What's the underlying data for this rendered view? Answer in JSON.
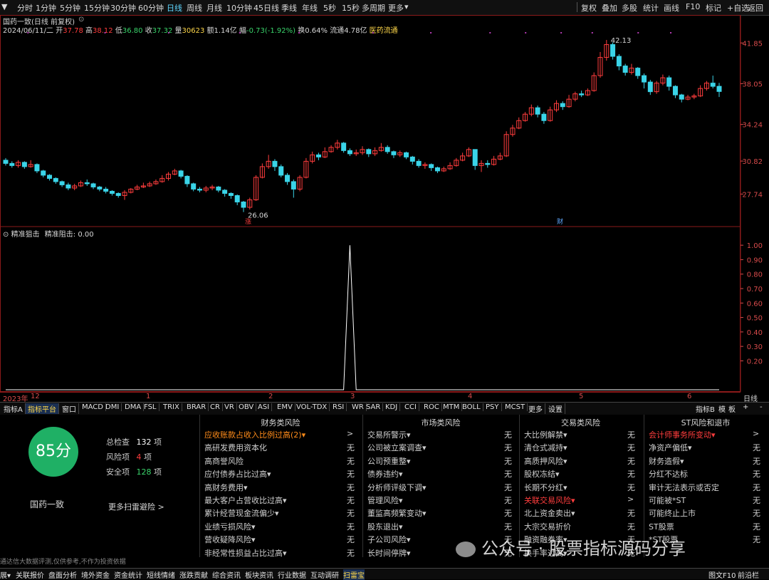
{
  "period_bar": {
    "items": [
      "分时",
      "1分钟",
      "5分钟",
      "15分钟",
      "30分钟",
      "60分钟",
      "日线",
      "周线",
      "月线",
      "10分钟",
      "45日线",
      "季线",
      "年线",
      "5秒",
      "15秒",
      "多周期",
      "更多"
    ],
    "active_index": 6,
    "right_items": [
      "复权",
      "叠加",
      "多股",
      "统计",
      "画线",
      "F10",
      "标记",
      "+自选",
      "返回"
    ]
  },
  "chart_header": {
    "title": "国药一致(日线 前复权)",
    "date": "2024/06/11/二",
    "open_label": "开",
    "open": "37.78",
    "high_label": "高",
    "high": "38.12",
    "low_label": "低",
    "low": "36.80",
    "close_label": "收",
    "close": "37.32",
    "volume_label": "量",
    "volume": "30623",
    "amount_label": "额",
    "amount": "1.14亿",
    "change_label": "幅",
    "change": "-0.73(-1.92%)",
    "turnover_label": "换",
    "turnover": "0.64%",
    "float_label": "流通",
    "float": "4.78亿",
    "sector": "医药流通"
  },
  "price_axis": [
    "41.85",
    "38.05",
    "34.24",
    "30.82",
    "27.74"
  ],
  "annotations": {
    "high": "42.13",
    "low": "26.06",
    "marker_up": "涨",
    "marker_fin": "财"
  },
  "indicator_panel": {
    "name": "精准狙击",
    "label": "精准阻击: 0.00",
    "axis": [
      "1.00",
      "0.90",
      "0.80",
      "0.70",
      "0.60",
      "0.50",
      "0.40",
      "0.30",
      "0.20"
    ]
  },
  "date_axis": {
    "ticks": [
      "2023年",
      "12",
      "1",
      "2",
      "3",
      "4",
      "5",
      "6"
    ],
    "right_label": "日线"
  },
  "indicator_tabs": [
    "指标A",
    "指标平台",
    "窗口",
    "MACD",
    "DMI",
    "DMA",
    "FSL",
    "TRIX",
    "BRAR",
    "CR",
    "VR",
    "OBV",
    "ASI",
    "EMV",
    "VOL-TDX",
    "RSI",
    "WR",
    "SAR",
    "KDJ",
    "CCI",
    "ROC",
    "MTM",
    "BOLL",
    "PSY",
    "MCST",
    "更多",
    "设置"
  ],
  "indicator_tabs_active": 1,
  "indicator_tabs_right": [
    "指标B",
    "模",
    "板",
    "+",
    "-"
  ],
  "risk": {
    "score": "85分",
    "stock_name": "国药一致",
    "total_label": "总检查",
    "total": "132",
    "total_unit": "项",
    "risk_label": "风险项",
    "risk_count": "4",
    "risk_unit": "项",
    "safe_label": "安全项",
    "safe_count": "128",
    "safe_unit": "项",
    "more_link": "更多扫雷避险 >",
    "disclaimer": "通达信大数据评测,仅供参考,不作为投资依据",
    "columns": [
      {
        "title": "财务类风险",
        "rows": [
          {
            "label": "应收账款占收入比例过高(2)▾",
            "value": ">",
            "flag": true
          },
          {
            "label": "高研发费用资本化",
            "value": "无"
          },
          {
            "label": "高商誉风险",
            "value": "无"
          },
          {
            "label": "应付债券占比过高▾",
            "value": "无"
          },
          {
            "label": "高财务费用▾",
            "value": "无"
          },
          {
            "label": "最大客户占营收比过高▾",
            "value": "无"
          },
          {
            "label": "累计经营现金流偏少▾",
            "value": "无"
          },
          {
            "label": "业绩亏损风险▾",
            "value": "无"
          },
          {
            "label": "营收疑降风险▾",
            "value": "无"
          },
          {
            "label": "非经常性损益占比过高▾",
            "value": "无"
          }
        ]
      },
      {
        "title": "市场类风险",
        "rows": [
          {
            "label": "交易所警示▾",
            "value": "无"
          },
          {
            "label": "公司被立案调查▾",
            "value": "无"
          },
          {
            "label": "公司预重整▾",
            "value": "无"
          },
          {
            "label": "债券违约▾",
            "value": "无"
          },
          {
            "label": "分析师评级下调▾",
            "value": "无"
          },
          {
            "label": "管理风险▾",
            "value": "无"
          },
          {
            "label": "董监高频繁变动▾",
            "value": "无"
          },
          {
            "label": "股东退出▾",
            "value": "无"
          },
          {
            "label": "子公司风险▾",
            "value": "无"
          },
          {
            "label": "长时间停牌▾",
            "value": "无"
          }
        ]
      },
      {
        "title": "交易类风险",
        "rows": [
          {
            "label": "大比例解禁▾",
            "value": "无"
          },
          {
            "label": "清仓式减持▾",
            "value": "无"
          },
          {
            "label": "高质押风险▾",
            "value": "无"
          },
          {
            "label": "股权冻结▾",
            "value": "无"
          },
          {
            "label": "长期不分红▾",
            "value": "无"
          },
          {
            "label": "关联交易风险▾",
            "value": ">",
            "flag": true
          },
          {
            "label": "北上资金卖出▾",
            "value": "无"
          },
          {
            "label": "大宗交易折价",
            "value": "无"
          },
          {
            "label": "融资融券率▾",
            "value": "无"
          },
          {
            "label": "换手率过高▾",
            "value": "无"
          }
        ]
      },
      {
        "title": "ST风险和退市",
        "rows": [
          {
            "label": "会计师事务所变动▾",
            "value": ">",
            "flag": true
          },
          {
            "label": "净资产偏低▾",
            "value": "无"
          },
          {
            "label": "财务造假▾",
            "value": "无"
          },
          {
            "label": "分红不达标",
            "value": "无"
          },
          {
            "label": "审计无法表示或否定",
            "value": "无"
          },
          {
            "label": "可能被*ST",
            "value": "无"
          },
          {
            "label": "可能终止上市",
            "value": "无"
          },
          {
            "label": "ST股票",
            "value": "无"
          },
          {
            "label": "*ST股票",
            "value": "无"
          },
          {
            "label": "",
            "value": ""
          }
        ]
      }
    ]
  },
  "watermark": "公众号 · 股票指标源码分享",
  "bottom_tabs": [
    "展▾",
    "关联报价",
    "盘面分析",
    "境外资金",
    "资金统计",
    "短线情绪",
    "涨跌贡献",
    "综合资讯",
    "板块资讯",
    "行业数据",
    "互动调研",
    "扫雷宝"
  ],
  "bottom_tabs_active": 11,
  "bottom_right": [
    "图文F10",
    "前沿栏"
  ],
  "colors": {
    "up": "#ff3d3d",
    "down": "#3ad4e8",
    "frame": "#8b1a1a",
    "score_bg": "#1fb065",
    "active_tab": "#ffd84a"
  },
  "chart_data": {
    "type": "candlestick",
    "title": "国药一致(日线 前复权)",
    "ylim": [
      25.5,
      43
    ],
    "candles": [
      [
        30.9,
        30.6,
        31.1,
        30.4
      ],
      [
        30.6,
        30.4,
        30.8,
        30.2
      ],
      [
        30.4,
        30.7,
        30.9,
        30.2
      ],
      [
        30.7,
        30.3,
        30.8,
        30.1
      ],
      [
        30.3,
        30.5,
        30.9,
        30.2
      ],
      [
        30.5,
        29.9,
        30.6,
        29.7
      ],
      [
        29.9,
        29.5,
        30.0,
        29.3
      ],
      [
        29.5,
        29.2,
        29.6,
        29.0
      ],
      [
        29.2,
        28.9,
        29.3,
        28.7
      ],
      [
        28.9,
        28.6,
        29.0,
        28.4
      ],
      [
        28.6,
        28.3,
        28.8,
        28.1
      ],
      [
        28.3,
        28.5,
        28.7,
        28.1
      ],
      [
        28.5,
        28.8,
        29.0,
        28.4
      ],
      [
        28.8,
        28.7,
        29.1,
        28.5
      ],
      [
        28.7,
        28.4,
        28.8,
        28.2
      ],
      [
        28.4,
        28.2,
        28.5,
        28.0
      ],
      [
        28.2,
        28.0,
        28.4,
        27.8
      ],
      [
        28.0,
        27.8,
        28.1,
        27.6
      ],
      [
        27.8,
        27.6,
        27.9,
        27.4
      ],
      [
        27.6,
        27.9,
        28.1,
        27.2
      ],
      [
        27.9,
        28.2,
        28.3,
        27.8
      ],
      [
        28.2,
        28.4,
        28.6,
        28.1
      ],
      [
        28.4,
        28.5,
        28.8,
        28.3
      ],
      [
        28.5,
        28.7,
        28.9,
        28.4
      ],
      [
        28.7,
        28.9,
        29.1,
        28.6
      ],
      [
        28.9,
        29.2,
        29.5,
        28.8
      ],
      [
        29.2,
        29.6,
        29.8,
        29.0
      ],
      [
        29.6,
        29.9,
        30.1,
        29.5
      ],
      [
        29.9,
        29.4,
        30.0,
        29.2
      ],
      [
        29.4,
        28.7,
        29.5,
        28.4
      ],
      [
        28.7,
        28.2,
        28.8,
        28.0
      ],
      [
        28.2,
        28.1,
        28.4,
        27.9
      ],
      [
        28.1,
        28.3,
        28.5,
        27.9
      ],
      [
        28.3,
        28.4,
        28.6,
        28.1
      ],
      [
        28.4,
        28.1,
        28.5,
        27.9
      ],
      [
        28.1,
        27.8,
        28.2,
        27.5
      ],
      [
        27.8,
        27.6,
        27.9,
        27.3
      ],
      [
        27.6,
        27.0,
        27.7,
        26.7
      ],
      [
        27.0,
        26.5,
        27.1,
        26.06
      ],
      [
        26.5,
        27.2,
        27.4,
        26.3
      ],
      [
        27.2,
        29.3,
        29.5,
        27.1
      ],
      [
        29.3,
        30.3,
        30.6,
        29.2
      ],
      [
        30.3,
        30.8,
        31.4,
        30.1
      ],
      [
        30.8,
        30.3,
        31.0,
        29.9
      ],
      [
        30.3,
        29.5,
        30.5,
        29.3
      ],
      [
        29.5,
        28.9,
        29.7,
        28.6
      ],
      [
        28.9,
        28.2,
        29.1,
        27.4
      ],
      [
        28.2,
        29.3,
        29.5,
        28.0
      ],
      [
        29.3,
        30.8,
        31.1,
        29.2
      ],
      [
        30.8,
        31.4,
        31.7,
        30.6
      ],
      [
        31.4,
        31.2,
        31.6,
        30.9
      ],
      [
        31.2,
        31.7,
        32.1,
        31.1
      ],
      [
        31.7,
        32.1,
        32.3,
        31.6
      ],
      [
        32.1,
        32.5,
        32.8,
        31.9
      ],
      [
        32.5,
        31.8,
        32.6,
        31.6
      ],
      [
        31.8,
        31.5,
        32.0,
        31.3
      ],
      [
        31.5,
        31.6,
        31.9,
        31.3
      ],
      [
        31.6,
        31.9,
        32.2,
        31.4
      ],
      [
        31.9,
        31.5,
        32.0,
        31.2
      ],
      [
        31.5,
        31.8,
        32.1,
        31.3
      ],
      [
        31.8,
        32.1,
        32.5,
        31.7
      ],
      [
        32.1,
        31.7,
        32.3,
        31.5
      ],
      [
        31.7,
        31.4,
        31.8,
        31.1
      ],
      [
        31.4,
        31.6,
        31.8,
        31.2
      ],
      [
        31.6,
        31.2,
        31.7,
        31.0
      ],
      [
        31.2,
        30.8,
        31.3,
        30.5
      ],
      [
        30.8,
        30.4,
        31.0,
        30.2
      ],
      [
        30.4,
        30.5,
        30.7,
        30.1
      ],
      [
        30.5,
        30.2,
        30.6,
        29.9
      ],
      [
        30.2,
        29.9,
        30.3,
        29.7
      ],
      [
        29.9,
        30.1,
        30.3,
        29.8
      ],
      [
        30.1,
        30.4,
        30.7,
        30.0
      ],
      [
        30.4,
        30.9,
        31.1,
        30.3
      ],
      [
        30.9,
        31.3,
        31.6,
        30.8
      ],
      [
        31.3,
        31.9,
        32.1,
        31.2
      ],
      [
        31.9,
        30.4,
        31.9,
        30.0
      ],
      [
        30.4,
        30.6,
        30.9,
        29.8
      ],
      [
        30.6,
        30.5,
        30.9,
        30.2
      ],
      [
        30.5,
        31.0,
        31.3,
        30.4
      ],
      [
        31.0,
        31.3,
        31.6,
        30.9
      ],
      [
        31.3,
        33.3,
        33.6,
        31.2
      ],
      [
        33.3,
        33.9,
        34.2,
        33.1
      ],
      [
        33.9,
        34.6,
        34.9,
        33.8
      ],
      [
        34.6,
        35.2,
        35.4,
        34.5
      ],
      [
        35.2,
        35.8,
        36.1,
        35.0
      ],
      [
        35.8,
        35.2,
        36.0,
        34.9
      ],
      [
        35.2,
        34.6,
        35.4,
        34.3
      ],
      [
        34.6,
        35.6,
        35.9,
        34.5
      ],
      [
        35.6,
        36.2,
        36.5,
        35.4
      ],
      [
        36.2,
        35.9,
        36.4,
        35.6
      ],
      [
        35.9,
        36.6,
        37.0,
        35.8
      ],
      [
        36.6,
        37.1,
        37.3,
        36.4
      ],
      [
        37.1,
        37.0,
        37.4,
        36.8
      ],
      [
        37.0,
        37.4,
        37.6,
        36.9
      ],
      [
        37.4,
        38.8,
        39.1,
        37.3
      ],
      [
        38.8,
        40.5,
        41.0,
        38.6
      ],
      [
        40.5,
        41.7,
        42.13,
        40.2
      ],
      [
        41.7,
        40.6,
        41.9,
        40.3
      ],
      [
        40.6,
        39.7,
        40.8,
        39.3
      ],
      [
        39.7,
        39.1,
        39.9,
        38.8
      ],
      [
        39.1,
        39.5,
        39.9,
        38.9
      ],
      [
        39.5,
        38.8,
        39.6,
        38.5
      ],
      [
        38.8,
        38.2,
        39.0,
        37.6
      ],
      [
        38.2,
        37.3,
        38.4,
        37.0
      ],
      [
        37.3,
        38.1,
        38.3,
        37.1
      ],
      [
        38.1,
        38.6,
        38.9,
        37.9
      ],
      [
        38.6,
        37.8,
        38.8,
        37.4
      ],
      [
        37.8,
        37.0,
        37.9,
        36.7
      ],
      [
        37.0,
        36.6,
        37.1,
        36.3
      ],
      [
        36.6,
        36.8,
        37.0,
        36.5
      ],
      [
        36.8,
        36.9,
        37.1,
        36.6
      ],
      [
        36.9,
        37.6,
        37.9,
        36.8
      ],
      [
        37.6,
        38.1,
        38.3,
        37.4
      ],
      [
        38.1,
        37.8,
        38.8,
        37.6
      ],
      [
        37.8,
        37.32,
        38.12,
        36.8
      ]
    ],
    "indicator": {
      "name": "精准阻击",
      "ylim": [
        0,
        1.05
      ],
      "spike_index": 55,
      "values_note_count": 115
    }
  }
}
